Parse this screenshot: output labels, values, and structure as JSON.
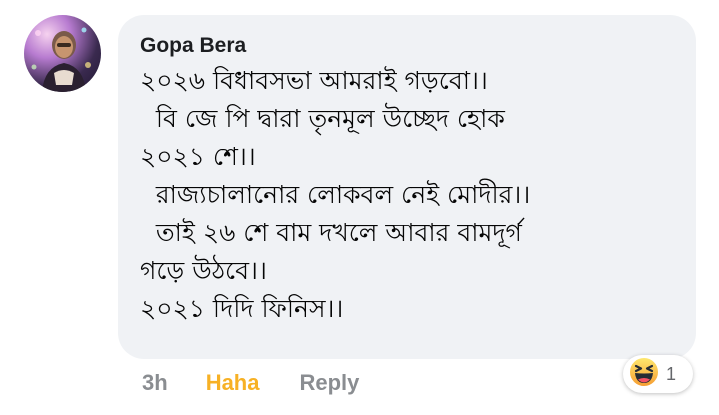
{
  "comment": {
    "author": "Gopa Bera",
    "lines": [
      "২০২৬ বিধাবসভা আমরাই গড়বো।।",
      "  বি জে পি দ্বারা তৃনমূল উচ্ছেদ হোক",
      "২০২১ শে।।",
      "  রাজ্যচালানোর লোকবল নেই মোদীর।।",
      "  তাই ২৬ শে বাম দখলে আবার বামদূর্গ",
      "গড়ে উঠবে।।",
      "২০২১ দিদি ফিনিস।।"
    ]
  },
  "actions": {
    "time": "3h",
    "haha": "Haha",
    "reply": "Reply"
  },
  "reactions": {
    "icon": "haha-emoji-icon",
    "count": "1"
  },
  "colors": {
    "bubble": "#f0f2f5",
    "haha": "#f7b125",
    "muted": "#8a8d91"
  }
}
